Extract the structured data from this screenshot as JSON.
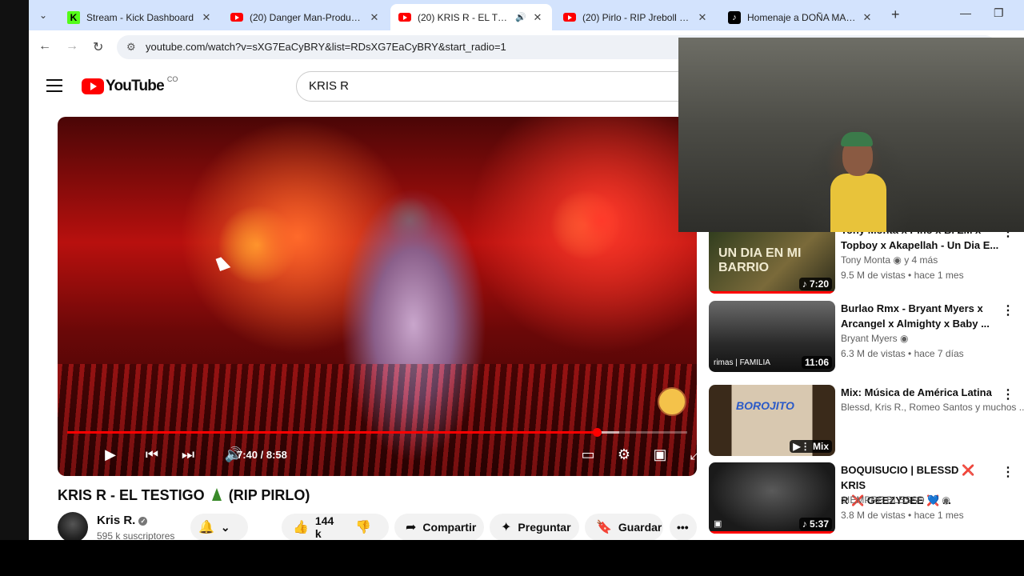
{
  "browser": {
    "tabs": [
      {
        "title": "Stream - Kick Dashboard",
        "favicon": "kick-icon"
      },
      {
        "title": "(20) Danger Man-Producto D",
        "favicon": "youtube-icon"
      },
      {
        "title": "(20) KRIS R - EL TESTIGO",
        "favicon": "youtube-icon",
        "active": true,
        "audio": true
      },
      {
        "title": "(20) Pirlo - RIP Jreboll (La Ca",
        "favicon": "youtube-icon"
      },
      {
        "title": "Homenaje a DOÑA MARTA:",
        "favicon": "tiktok-icon"
      }
    ],
    "url": "youtube.com/watch?v=sXG7EaCyBRY&list=RDsXG7EaCyBRY&start_radio=1"
  },
  "youtube": {
    "logo_text": "YouTube",
    "country_code": "CO",
    "search_value": "KRIS R"
  },
  "player": {
    "time": "7:40 / 8:58",
    "played_fraction": 0.854,
    "buffered_fraction": 0.89
  },
  "video": {
    "title_main": "KRIS R - EL TESTIGO",
    "title_tail": "(RIP PIRLO)",
    "channel": "Kris R.",
    "subscribers": "595 k suscriptores",
    "likes": "144 k",
    "share": "Compartir",
    "ask": "Preguntar",
    "save": "Guardar"
  },
  "recommendations": [
    {
      "title_line1": "Tony Monta x Pino x B. ZM x",
      "title_line2": "Topboy x Akapellah - Un Dia E...",
      "channel": "Tony Monta",
      "channel_extra": "y 4 más",
      "meta": "9.5 M de vistas • hace 1 mes",
      "duration": "7:20",
      "thumb_text": "UN DIA EN MI BARRIO"
    },
    {
      "title_line1": "Burlao Rmx - Bryant Myers x",
      "title_line2": "Arcangel x Almighty x Baby ...",
      "channel": "Bryant Myers",
      "meta": "6.3 M de vistas • hace 7 días",
      "duration": "11:06",
      "thumb_text": "rimas | FAMILIA"
    },
    {
      "title_line1": "Mix: Música de América Latina",
      "title_line2": "",
      "channel": "Blessd, Kris R., Romeo Santos y muchos ...",
      "meta": "",
      "duration": "Mix",
      "thumb_text": "BOROJITO"
    },
    {
      "title_line1": "BOQUISUCIO | BLESSD ❌ KRIS",
      "title_line2": "R ❌ GEEZYDEE ❌ ...",
      "channel": "SIEMPRE BLESSD 💙",
      "meta": "3.8 M de vistas • hace 1 mes",
      "duration": "5:37",
      "thumb_text": ""
    }
  ]
}
